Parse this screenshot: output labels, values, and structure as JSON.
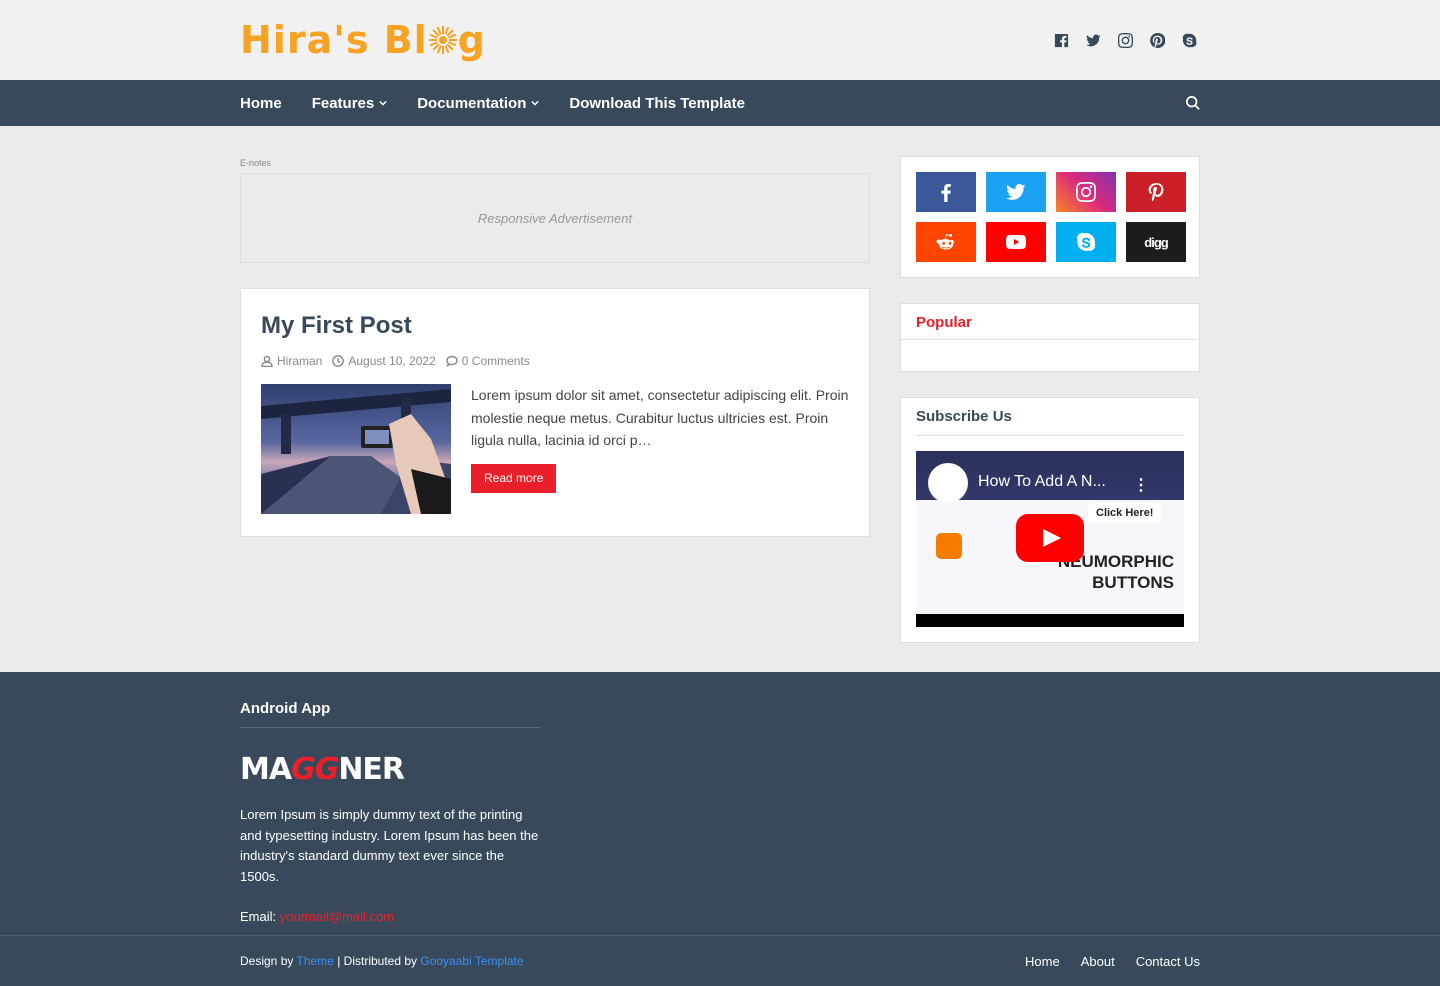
{
  "header": {
    "logo_text_a": "Hira's Bl",
    "logo_text_b": "g",
    "social": [
      "facebook-icon",
      "twitter-icon",
      "instagram-icon",
      "pinterest-icon",
      "skype-icon"
    ]
  },
  "nav": {
    "items": [
      {
        "label": "Home",
        "dropdown": false
      },
      {
        "label": "Features",
        "dropdown": true
      },
      {
        "label": "Documentation",
        "dropdown": true
      },
      {
        "label": "Download This Template",
        "dropdown": false
      }
    ]
  },
  "main": {
    "ad_label": "E-notes",
    "ad_text": "Responsive Advertisement",
    "post": {
      "title": "My First Post",
      "author": "Hiraman",
      "date": "August 10, 2022",
      "comments": "0 Comments",
      "excerpt": "Lorem ipsum dolor sit amet, consectetur adipiscing elit. Proin molestie neque metus. Curabitur luctus ultricies est. Proin ligula nulla, lacinia id orci p…",
      "read_more": "Read more"
    }
  },
  "sidebar": {
    "social_buttons": [
      {
        "name": "facebook",
        "color": "#3b5998"
      },
      {
        "name": "twitter",
        "color": "#1da1f2"
      },
      {
        "name": "instagram",
        "color": "#c13584"
      },
      {
        "name": "pinterest",
        "color": "#cb2027"
      },
      {
        "name": "reddit",
        "color": "#ff4500"
      },
      {
        "name": "youtube",
        "color": "#ff0000"
      },
      {
        "name": "skype",
        "color": "#00aff0"
      },
      {
        "name": "digg",
        "color": "#1c1c1c"
      }
    ],
    "digg_label": "digg",
    "popular_title": "Popular",
    "subscribe_title": "Subscribe Us",
    "video": {
      "title": "How To Add A N...",
      "overlay_button": "Click Here!",
      "overlay_text_1": "NEUMORPHIC",
      "overlay_text_2": "BUTTONS"
    }
  },
  "footer": {
    "title": "Android App",
    "logo_a": "MA",
    "logo_b": "GG",
    "logo_c": "NER",
    "text": "Lorem Ipsum is simply dummy text of the printing and typesetting industry. Lorem Ipsum has been the industry's standard dummy text ever since the 1500s.",
    "email_label": "Email:",
    "email": "yourmail@mail.com",
    "credit_a": "Design by",
    "credit_theme": "Theme",
    "credit_b": "| Distributed by",
    "credit_dist": "Gooyaabi Template",
    "links": [
      "Home",
      "About",
      "Contact Us"
    ]
  },
  "colors": {
    "accent": "#e9202b",
    "nav_bg": "#37495a",
    "logo": "#f6a323",
    "link_blue": "#3d8ef0"
  }
}
